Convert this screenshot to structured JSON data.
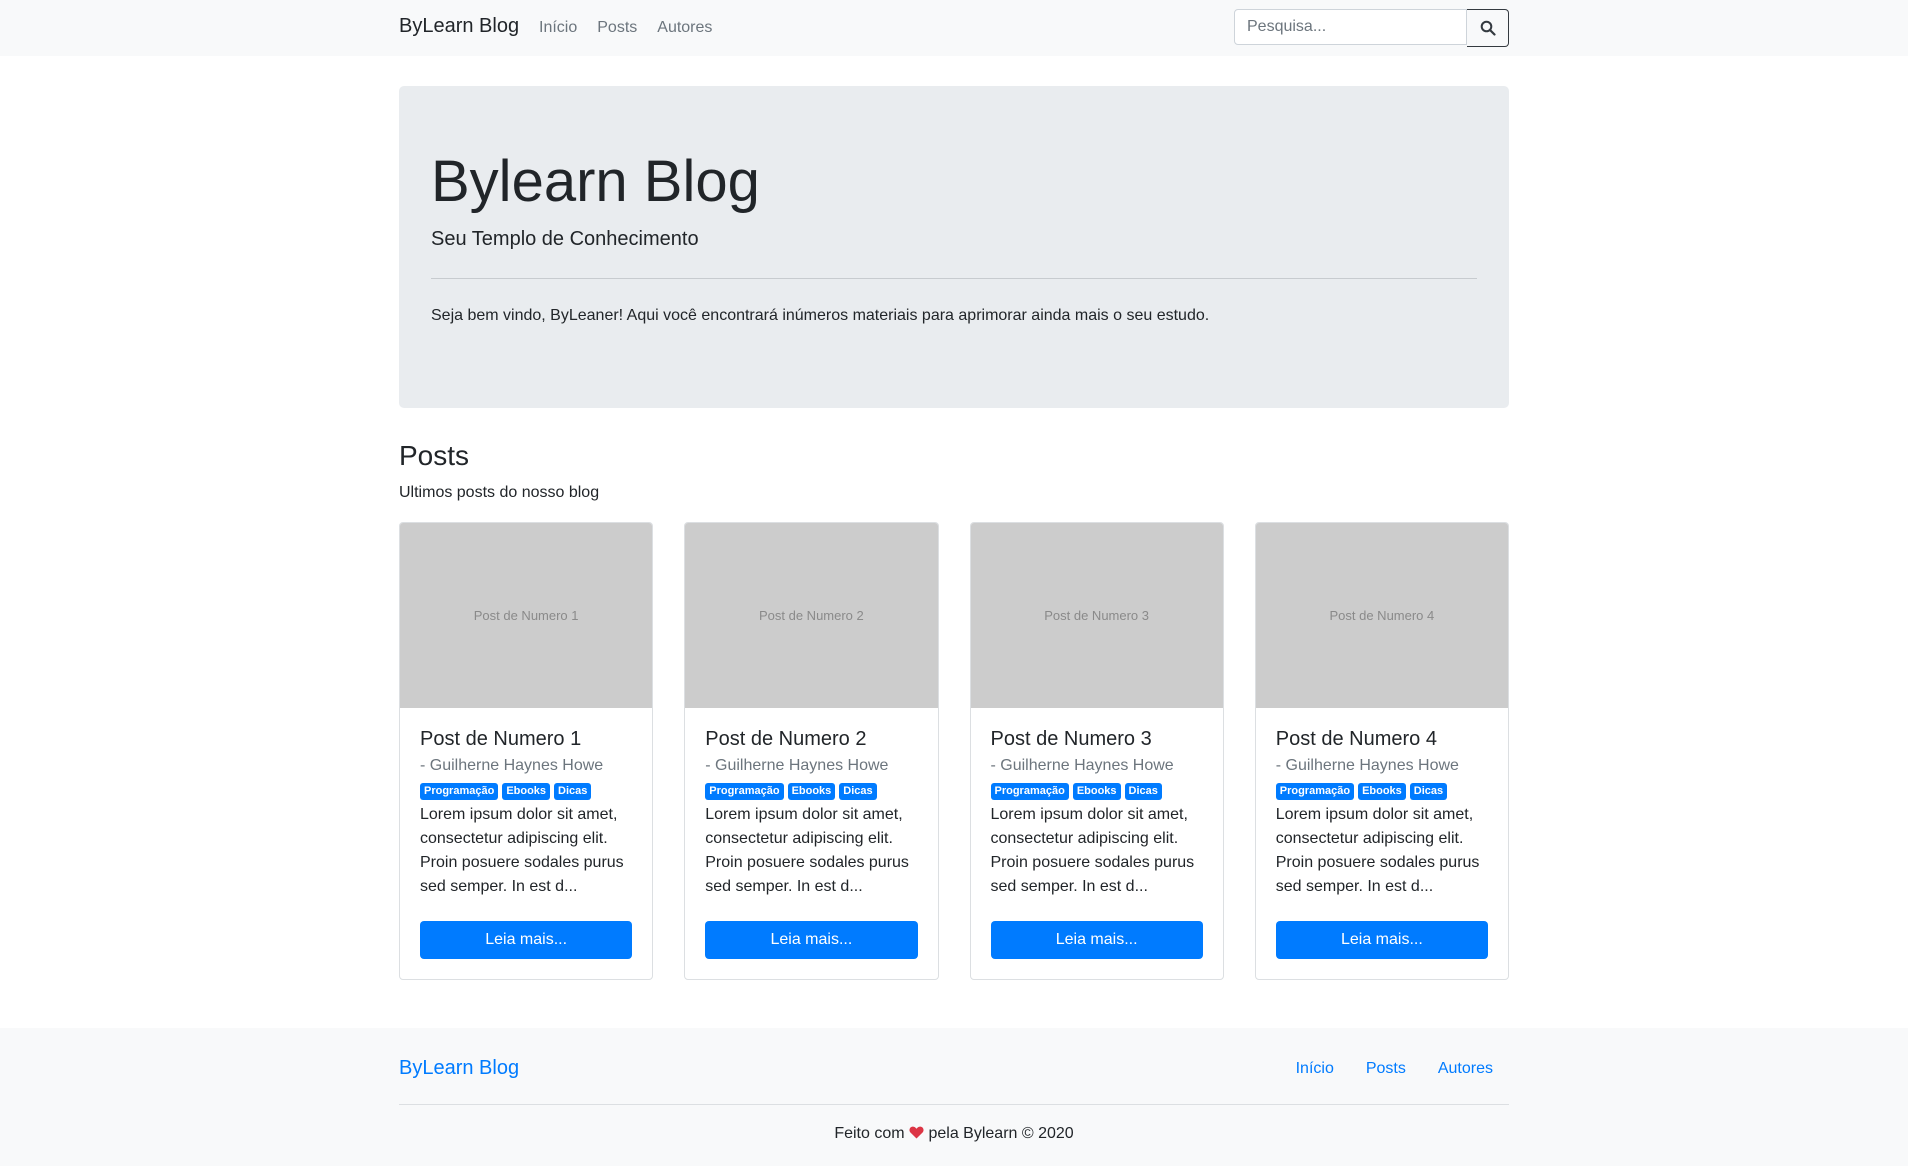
{
  "navbar": {
    "brand": "ByLearn Blog",
    "links": [
      "Início",
      "Posts",
      "Autores"
    ],
    "search_placeholder": "Pesquisa..."
  },
  "jumbotron": {
    "title": "Bylearn Blog",
    "subtitle": "Seu Templo de Conhecimento",
    "welcome": "Seja bem vindo, ByLeaner! Aqui você encontrará inúmeros materiais para aprimorar ainda mais o seu estudo."
  },
  "posts_section": {
    "title": "Posts",
    "subtitle": "Ultimos posts do nosso blog"
  },
  "cards": [
    {
      "thumb": "Post de Numero 1",
      "title": "Post de Numero 1",
      "author": "- Guilherne Haynes Howe",
      "tags": [
        "Programação",
        "Ebooks",
        "Dicas"
      ],
      "excerpt": "Lorem ipsum dolor sit amet, consectetur adipiscing elit. Proin posuere sodales purus sed semper. In est d...",
      "button": "Leia mais..."
    },
    {
      "thumb": "Post de Numero 2",
      "title": "Post de Numero 2",
      "author": "- Guilherne Haynes Howe",
      "tags": [
        "Programação",
        "Ebooks",
        "Dicas"
      ],
      "excerpt": "Lorem ipsum dolor sit amet, consectetur adipiscing elit. Proin posuere sodales purus sed semper. In est d...",
      "button": "Leia mais..."
    },
    {
      "thumb": "Post de Numero 3",
      "title": "Post de Numero 3",
      "author": "- Guilherne Haynes Howe",
      "tags": [
        "Programação",
        "Ebooks",
        "Dicas"
      ],
      "excerpt": "Lorem ipsum dolor sit amet, consectetur adipiscing elit. Proin posuere sodales purus sed semper. In est d...",
      "button": "Leia mais..."
    },
    {
      "thumb": "Post de Numero 4",
      "title": "Post de Numero 4",
      "author": "- Guilherne Haynes Howe",
      "tags": [
        "Programação",
        "Ebooks",
        "Dicas"
      ],
      "excerpt": "Lorem ipsum dolor sit amet, consectetur adipiscing elit. Proin posuere sodales purus sed semper. In est d...",
      "button": "Leia mais..."
    }
  ],
  "footer": {
    "brand": "ByLearn Blog",
    "links": [
      "Início",
      "Posts",
      "Autores"
    ],
    "made_with": "Feito com",
    "made_by": "pela Bylearn © 2020"
  },
  "colors": {
    "primary": "#007bff",
    "heart": "#dc3545",
    "jumbotron_bg": "#e9ecef",
    "navbar_bg": "#f8f9fa"
  },
  "icons": {
    "search": "search-icon",
    "heart": "heart-icon"
  }
}
